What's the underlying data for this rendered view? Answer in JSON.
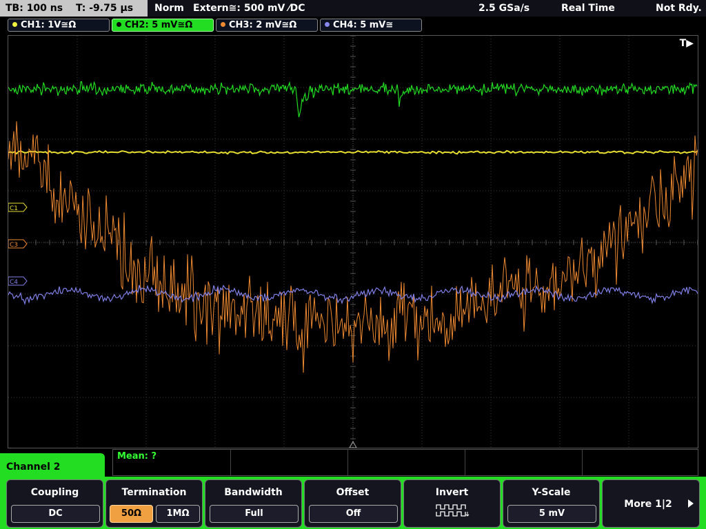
{
  "status": {
    "timebase": "TB: 100 ns",
    "trigger_time": "T: -9.75 µs",
    "trigger_mode": "Norm",
    "trigger_source": "Extern≅: 500 mV ⁄DC",
    "sample_rate": "2.5 GSa/s",
    "acquisition": "Real Time",
    "state": "Not Rdy."
  },
  "channels": [
    {
      "label": "CH1: 1V≅Ω",
      "color": "#f0f040",
      "active": false
    },
    {
      "label": "CH2: 5 mV≅Ω",
      "color": "#22dd22",
      "active": true
    },
    {
      "label": "CH3: 2 mV≅Ω",
      "color": "#f08a30",
      "active": false
    },
    {
      "label": "CH4: 5 mV≅",
      "color": "#8888ee",
      "active": false
    }
  ],
  "screen": {
    "trigger_marker": "T▶",
    "markers": {
      "c1": "C1",
      "c3": "C3",
      "c4": "C4"
    }
  },
  "measurement": {
    "mean": "Mean: ?"
  },
  "menu": {
    "title": "Channel 2",
    "coupling": {
      "title": "Coupling",
      "value": "DC"
    },
    "termination": {
      "title": "Termination",
      "opt_50": "50Ω",
      "opt_1m": "1MΩ",
      "selected": "50Ω"
    },
    "bandwidth": {
      "title": "Bandwidth",
      "value": "Full"
    },
    "offset": {
      "title": "Offset",
      "value": "Off"
    },
    "invert": {
      "title": "Invert",
      "icon": "invert-waveform-icon"
    },
    "yscale": {
      "title": "Y-Scale",
      "value": "5 mV"
    },
    "more": {
      "title": "More 1|2",
      "icon": "right-arrow-icon"
    }
  },
  "colors": {
    "ch1": "#f0f040",
    "ch2": "#22dd22",
    "ch3": "#f08a30",
    "ch4": "#8888ee",
    "menu_accent": "#22dd22",
    "selected_option": "#f0a040"
  }
}
